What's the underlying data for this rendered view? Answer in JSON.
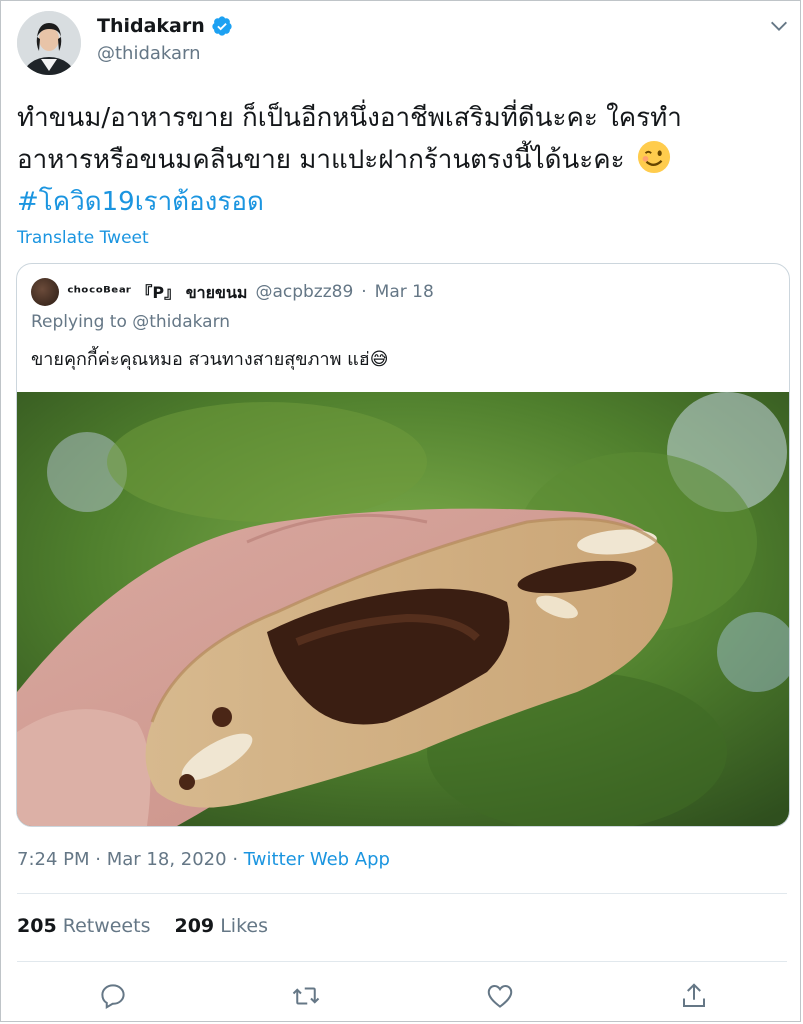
{
  "author": {
    "display_name": "Thidakarn",
    "handle": "@thidakarn"
  },
  "tweet": {
    "line1": "ทำขนม/อาหารขาย ก็เป็นอีกหนึ่งอาชีพเสริมที่ดีนะคะ ใครทำ",
    "line2": "อาหารหรือขนมคลีนขาย มาแปะฝากร้านตรงนี้ได้นะคะ",
    "hashtag": "#โควิด19เราต้องรอด",
    "translate_label": "Translate Tweet"
  },
  "quote": {
    "name": "ᶜʰᵒᶜᵒᴮᵉᵃʳ 『P』 ขายขนม",
    "handle": "@acpbzz89",
    "separator": "·",
    "date": "Mar 18",
    "replying_label": "Replying to @thidakarn",
    "text": "ขายคุกกี้ค่ะคุณหมอ สวนทางสายสุขภาพ แฮ่😅"
  },
  "meta": {
    "time": "7:24 PM",
    "sep1": "·",
    "date": "Mar 18, 2020",
    "sep2": "·",
    "via": "Twitter Web App"
  },
  "stats": {
    "retweets_count": "205",
    "retweets_label": "Retweets",
    "likes_count": "209",
    "likes_label": "Likes"
  },
  "icons": {
    "verified": "verified-badge-icon",
    "caret": "chevron-down-icon",
    "reply": "reply-icon",
    "retweet": "retweet-icon",
    "like": "heart-icon",
    "share": "share-icon"
  },
  "colors": {
    "link": "#1b95e0",
    "muted": "#657786",
    "text": "#14171a",
    "border": "#ccd6dd"
  }
}
